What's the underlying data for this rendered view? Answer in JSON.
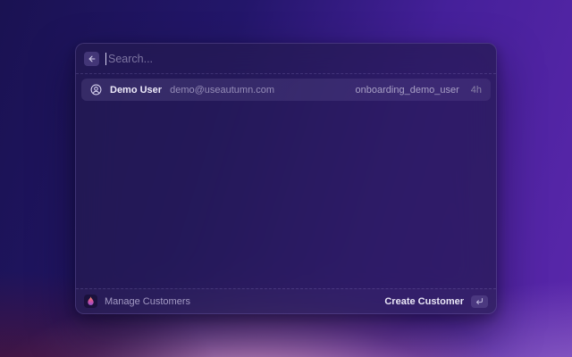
{
  "search": {
    "placeholder": "Search...",
    "value": ""
  },
  "results": [
    {
      "name": "Demo User",
      "email": "demo@useautumn.com",
      "id": "onboarding_demo_user",
      "time": "4h"
    }
  ],
  "footer": {
    "app_label": "Manage Customers",
    "action_label": "Create Customer"
  },
  "icons": {
    "back": "arrow-left-icon",
    "result_item": "user-circle-icon",
    "footer_logo": "flame-icon",
    "submit_hint": "enter-return-icon"
  },
  "colors": {
    "panel": "rgba(36,26,77,0.72)",
    "bg_navy": "#1a1252",
    "bg_purple": "#5a27ab",
    "bg_pink": "#c793bd",
    "bg_plum": "#48153e",
    "flame_orange": "#f6a04e",
    "flame_pink": "#d4549b",
    "flame_purple": "#8b4fd8",
    "selected_row": "rgba(215,203,255,0.10)"
  }
}
